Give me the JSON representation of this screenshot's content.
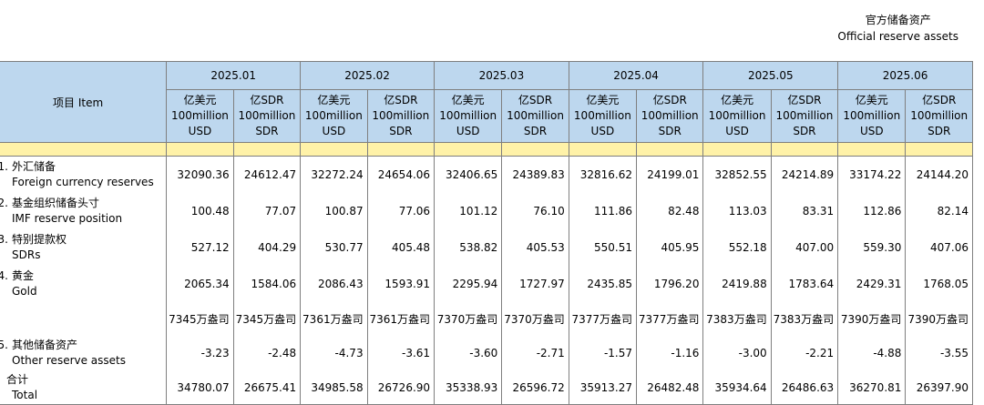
{
  "header": {
    "title_cn": "官方储备资产",
    "title_en": "Official reserve assets"
  },
  "table": {
    "item_header": "项目 Item",
    "months": [
      "2025.01",
      "2025.02",
      "2025.03",
      "2025.04",
      "2025.05",
      "2025.06"
    ],
    "unit_usd": [
      "亿美元",
      "100million",
      "USD"
    ],
    "unit_sdr": [
      "亿SDR",
      "100million",
      "SDR"
    ],
    "rows": [
      {
        "num": "1.",
        "cn": "外汇储备",
        "en": "Foreign currency reserves",
        "values": [
          "32090.36",
          "24612.47",
          "32272.24",
          "24654.06",
          "32406.65",
          "24389.83",
          "32816.62",
          "24199.01",
          "32852.55",
          "24214.89",
          "33174.22",
          "24144.20"
        ]
      },
      {
        "num": "2.",
        "cn": "基金组织储备头寸",
        "en": "IMF reserve position",
        "values": [
          "100.48",
          "77.07",
          "100.87",
          "77.06",
          "101.12",
          "76.10",
          "111.86",
          "82.48",
          "113.03",
          "83.31",
          "112.86",
          "82.14"
        ]
      },
      {
        "num": "3.",
        "cn": "特别提款权",
        "en": "SDRs",
        "values": [
          "527.12",
          "404.29",
          "530.77",
          "405.48",
          "538.82",
          "405.53",
          "550.51",
          "405.95",
          "552.18",
          "407.00",
          "559.30",
          "407.06"
        ]
      },
      {
        "num": "4.",
        "cn": "黄金",
        "en": "Gold",
        "values": [
          "2065.34",
          "1584.06",
          "2086.43",
          "1593.91",
          "2295.94",
          "1727.97",
          "2435.85",
          "1796.20",
          "2419.88",
          "1783.64",
          "2429.31",
          "1768.05"
        ]
      }
    ],
    "gold_ounces": [
      "7345万盎司",
      "7345万盎司",
      "7361万盎司",
      "7361万盎司",
      "7370万盎司",
      "7370万盎司",
      "7377万盎司",
      "7377万盎司",
      "7383万盎司",
      "7383万盎司",
      "7390万盎司",
      "7390万盎司"
    ],
    "other_row": {
      "num": "5.",
      "cn": "其他储备资产",
      "en": "Other reserve assets",
      "values": [
        "-3.23",
        "-2.48",
        "-4.73",
        "-3.61",
        "-3.60",
        "-2.71",
        "-1.57",
        "-1.16",
        "-3.00",
        "-2.21",
        "-4.88",
        "-3.55"
      ]
    },
    "total_row": {
      "cn": "合计",
      "en": "Total",
      "values": [
        "34780.07",
        "26675.41",
        "34985.58",
        "26726.90",
        "35338.93",
        "26596.72",
        "35913.27",
        "26482.48",
        "35934.64",
        "26486.63",
        "36270.81",
        "26397.90"
      ]
    }
  },
  "colors": {
    "header_bg": "#bdd7ee",
    "spacer_bg": "#fff2a8",
    "border": "#7f7f7f"
  }
}
